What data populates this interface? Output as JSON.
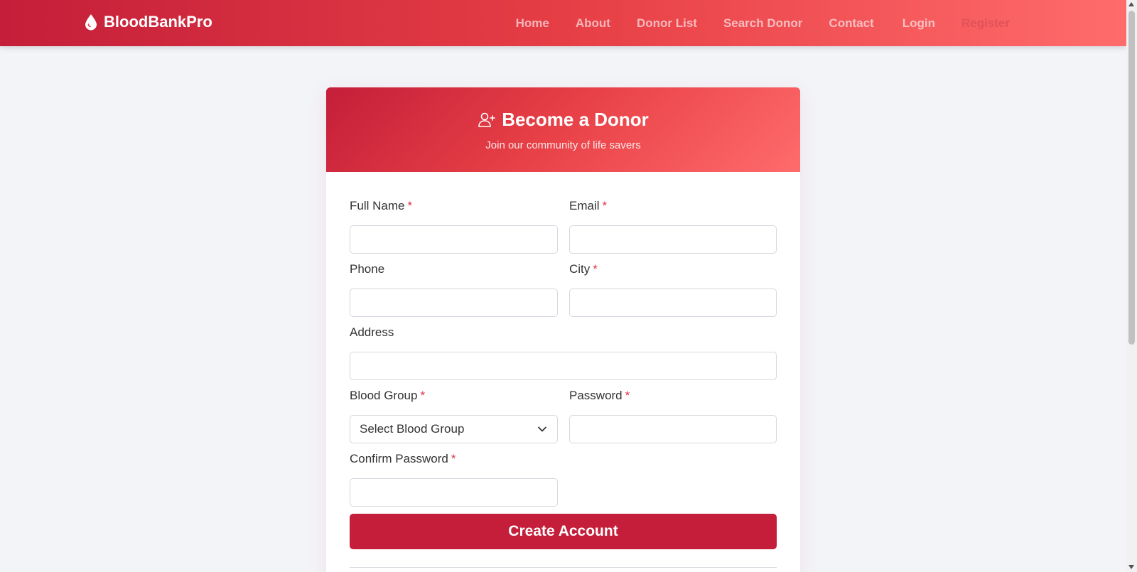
{
  "brand": {
    "name": "BloodBankPro",
    "icon": "blood-drop-icon"
  },
  "nav": {
    "links": [
      "Home",
      "About",
      "Donor List",
      "Search Donor",
      "Contact"
    ],
    "login": "Login",
    "register": "Register"
  },
  "card": {
    "title": "Become a Donor",
    "title_icon": "user-plus-icon",
    "subtitle": "Join our community of life savers"
  },
  "form": {
    "required_mark": "*",
    "full_name": {
      "label": "Full Name",
      "value": ""
    },
    "email": {
      "label": "Email",
      "value": ""
    },
    "phone": {
      "label": "Phone",
      "value": ""
    },
    "city": {
      "label": "City",
      "value": ""
    },
    "address": {
      "label": "Address",
      "value": ""
    },
    "blood_group": {
      "label": "Blood Group",
      "selected": "Select Blood Group",
      "icon": "chevron-down-icon"
    },
    "password": {
      "label": "Password",
      "value": ""
    },
    "confirm_password": {
      "label": "Confirm Password",
      "value": ""
    },
    "submit_label": "Create Account"
  },
  "colors": {
    "primary": "#c41e3a",
    "gradient_end": "#ff6b6b",
    "background": "#f3f4f8",
    "required": "#dc3545"
  }
}
